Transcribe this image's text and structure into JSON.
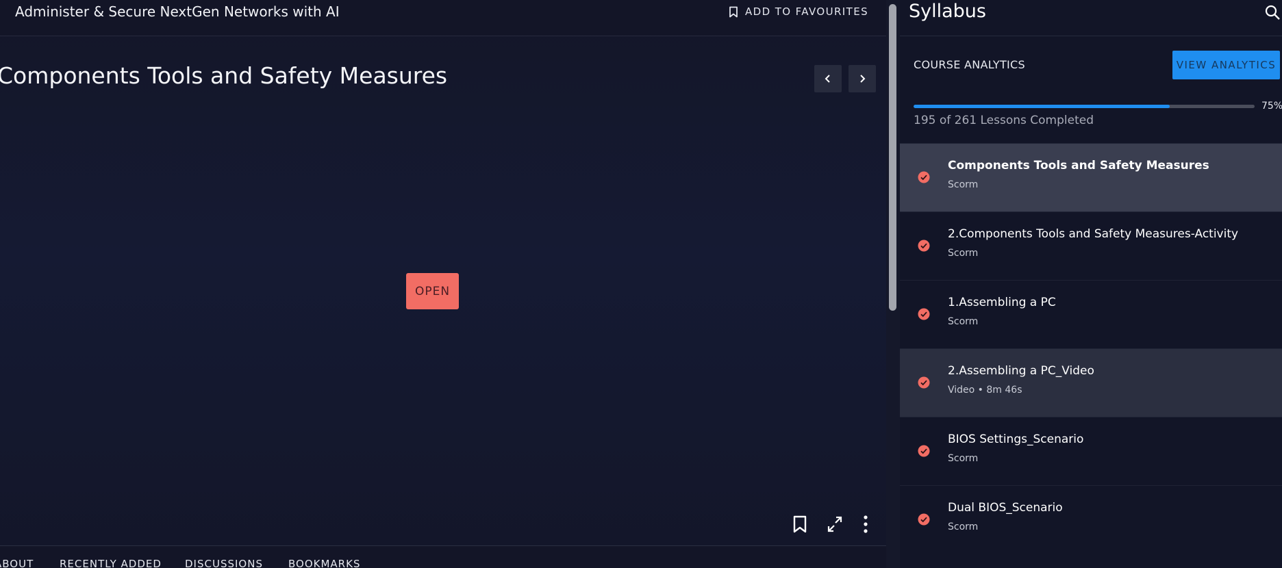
{
  "header": {
    "course_title": "Administer & Secure NextGen Networks with AI",
    "add_to_favourites": "ADD TO FAVOURITES"
  },
  "content": {
    "lesson_title": "Components Tools and Safety Measures",
    "open_button": "OPEN"
  },
  "tabs": [
    {
      "label": "ABOUT"
    },
    {
      "label": "RECENTLY ADDED"
    },
    {
      "label": "DISCUSSIONS"
    },
    {
      "label": "BOOKMARKS"
    }
  ],
  "syllabus": {
    "title": "Syllabus",
    "analytics_label": "COURSE ANALYTICS",
    "analytics_button": "VIEW ANALYTICS",
    "progress_percent": "75%",
    "progress_fraction": 0.75,
    "progress_text": "195 of 261 Lessons Completed",
    "items": [
      {
        "name": "Components Tools and Safety Measures",
        "sub": "Scorm",
        "state": "active"
      },
      {
        "name": "2.Components Tools and Safety Measures-Activity",
        "sub": "Scorm",
        "state": ""
      },
      {
        "name": "1.Assembling a PC",
        "sub": "Scorm",
        "state": ""
      },
      {
        "name": "2.Assembling a PC_Video",
        "sub": "Video • 8m 46s",
        "state": "hover"
      },
      {
        "name": "BIOS Settings_Scenario",
        "sub": "Scorm",
        "state": ""
      },
      {
        "name": "Dual BIOS_Scenario",
        "sub": "Scorm",
        "state": ""
      }
    ]
  },
  "colors": {
    "accent_blue": "#1f8ef0",
    "open_button": "#f26d64",
    "check_icon": "#f26d64"
  },
  "icons": [
    "chevron-left-icon",
    "bookmark-icon",
    "chevron-right-icon",
    "fullscreen-icon",
    "more-vertical-icon",
    "search-icon",
    "check-circle-icon"
  ]
}
